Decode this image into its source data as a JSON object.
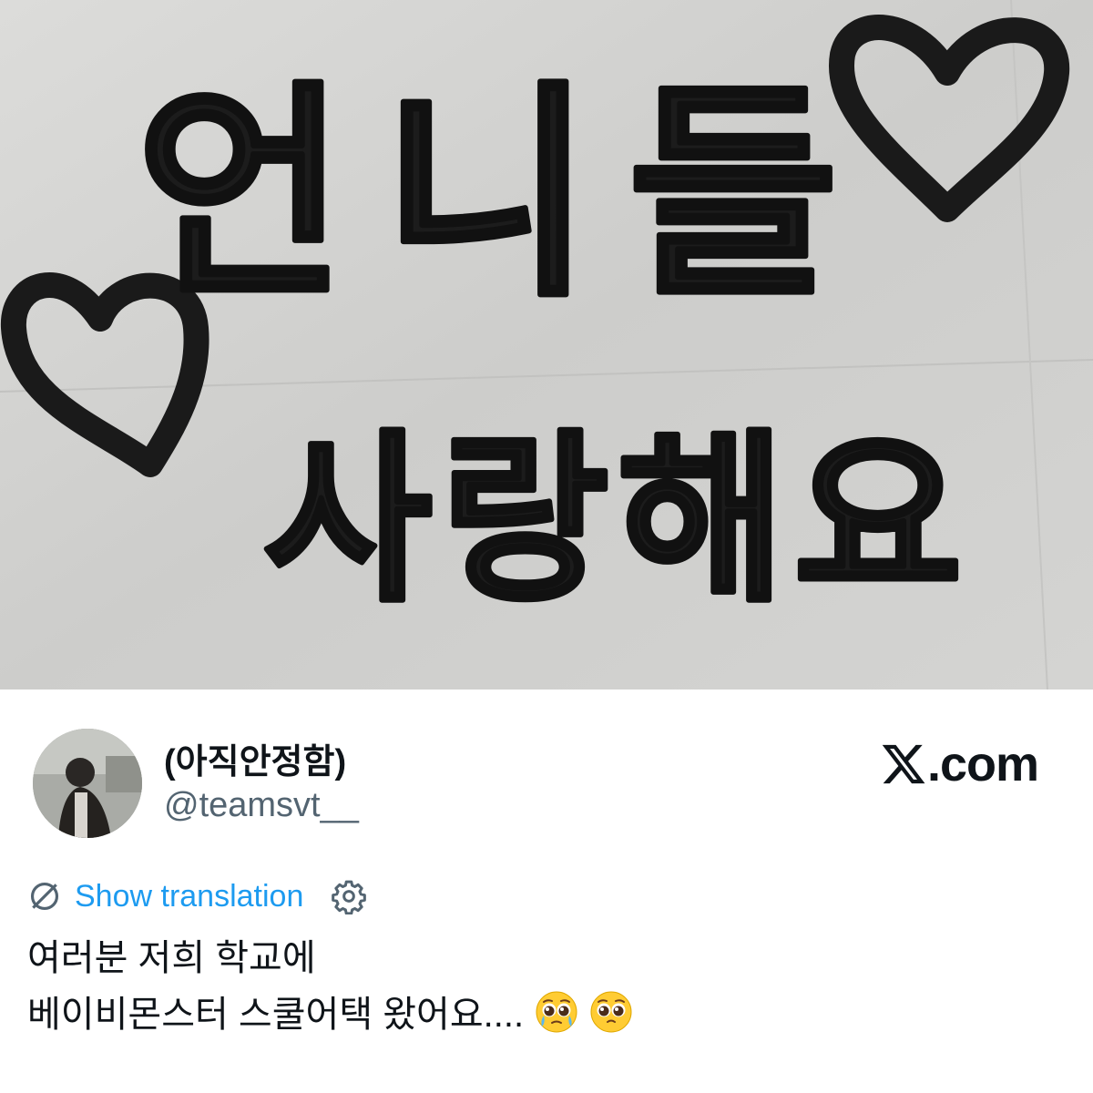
{
  "photo": {
    "sign_line1": "언니들",
    "sign_line2": "사랑해요"
  },
  "author": {
    "display_name": "(아직안정함)",
    "handle": "@teamsvt__"
  },
  "brand": {
    "text": ".com",
    "icon": "x-logo-icon"
  },
  "translation": {
    "icon": "globe-slash-icon",
    "label": "Show translation",
    "settings_icon": "gear-icon"
  },
  "tweet": {
    "line1": "여러분 저희 학교에",
    "line2": "베이비몬스터 스쿨어택 왔어요....",
    "emojis": [
      "pleading-face-tears-emoji",
      "pleading-face-emoji"
    ]
  },
  "colors": {
    "link": "#1d9bf0",
    "text": "#0f1419",
    "secondary": "#536471"
  }
}
